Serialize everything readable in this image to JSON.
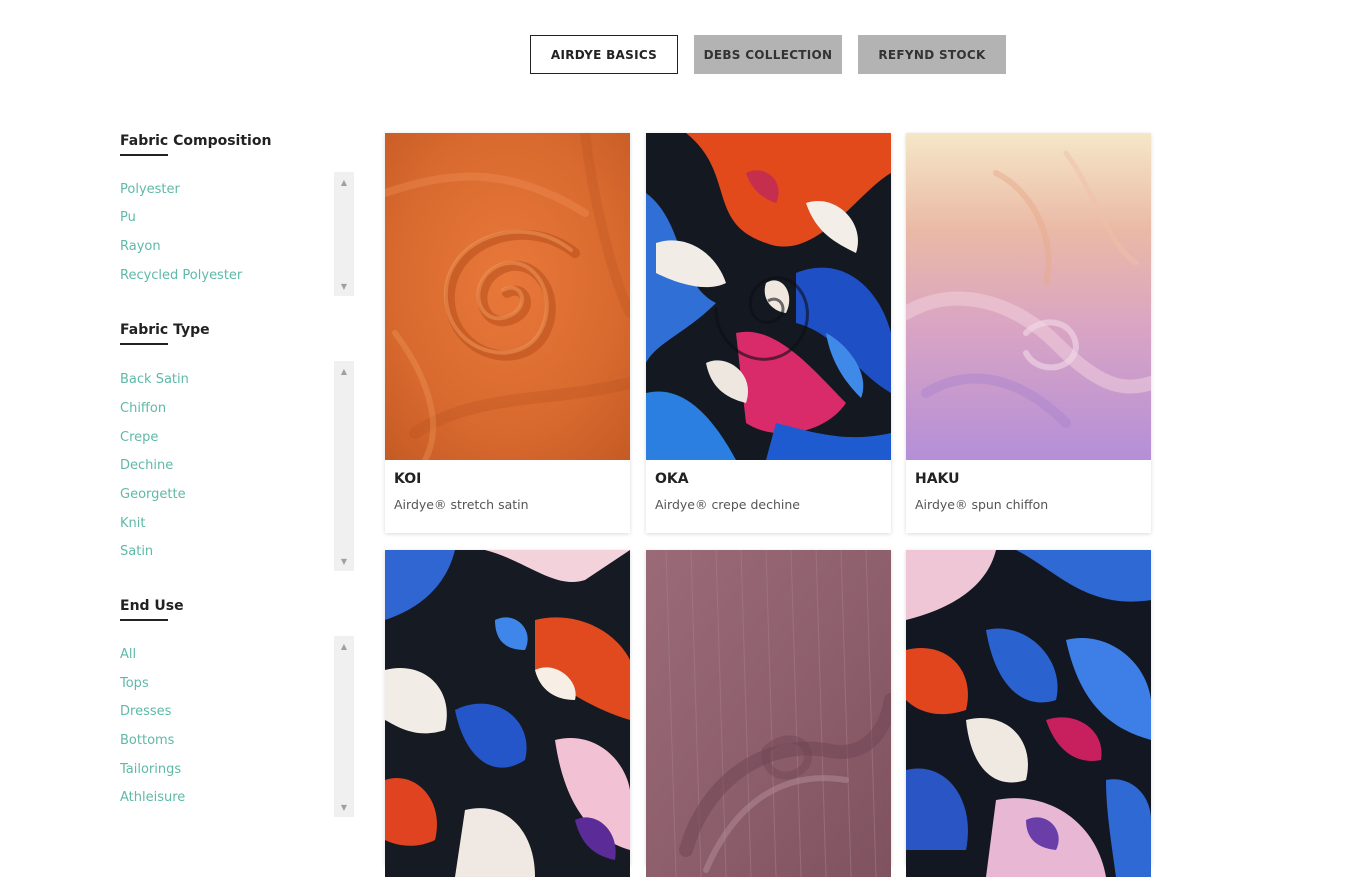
{
  "tabs": [
    {
      "label": "AIRDYE BASICS",
      "active": true
    },
    {
      "label": "DEBS COLLECTION",
      "active": false
    },
    {
      "label": "REFYND STOCK",
      "active": false
    }
  ],
  "filters": {
    "composition": {
      "title": "Fabric Composition",
      "items": [
        "Polyester",
        "Pu",
        "Rayon",
        "Recycled Polyester"
      ]
    },
    "type": {
      "title": "Fabric Type",
      "items": [
        "Back Satin",
        "Chiffon",
        "Crepe",
        "Dechine",
        "Georgette",
        "Knit",
        "Satin"
      ]
    },
    "end_use": {
      "title": "End Use",
      "items": [
        "All",
        "Tops",
        "Dresses",
        "Bottoms",
        "Tailorings",
        "Athleisure"
      ]
    }
  },
  "products": [
    {
      "name": "KOI",
      "desc": "Airdye® stretch satin"
    },
    {
      "name": "OKA",
      "desc": "Airdye® crepe dechine"
    },
    {
      "name": "HAKU",
      "desc": "Airdye® spun chiffon"
    },
    {
      "name": "",
      "desc": ""
    },
    {
      "name": "",
      "desc": ""
    },
    {
      "name": "",
      "desc": ""
    }
  ],
  "colors": {
    "accent_link": "#5fb9a8",
    "tab_inactive_bg": "#b3b3b3"
  }
}
